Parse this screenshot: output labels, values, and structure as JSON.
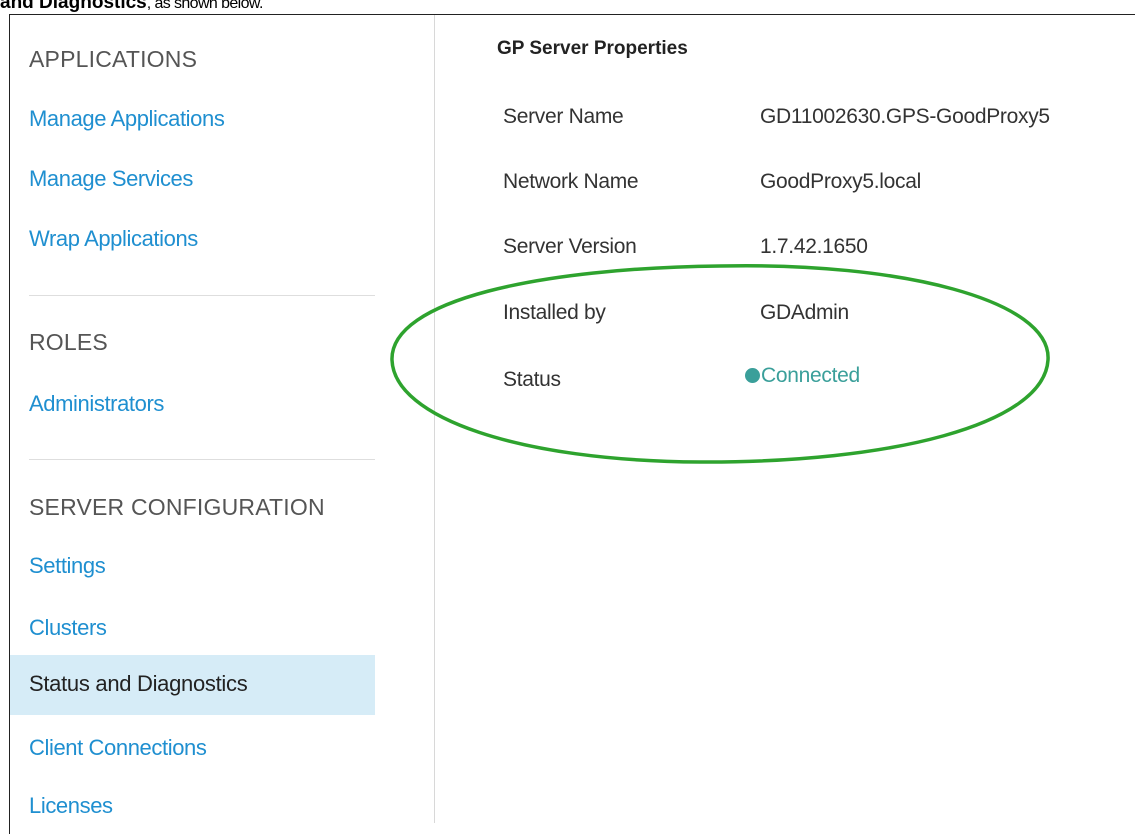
{
  "caption": {
    "bold_text": "and Diagnostics",
    "rest_text": ", as shown below."
  },
  "sidebar": {
    "sections": [
      {
        "heading": "APPLICATIONS",
        "items": [
          "Manage Applications",
          "Manage Services",
          "Wrap Applications"
        ]
      },
      {
        "heading": "ROLES",
        "items": [
          "Administrators"
        ]
      },
      {
        "heading": "SERVER CONFIGURATION",
        "items": [
          "Settings",
          "Clusters",
          "Status and Diagnostics",
          "Client Connections",
          "Licenses"
        ]
      }
    ],
    "active_item": "Status and Diagnostics"
  },
  "main": {
    "title": "GP Server Properties",
    "properties": [
      {
        "label": "Server Name",
        "value": "GD11002630.GPS-GoodProxy5"
      },
      {
        "label": "Network Name",
        "value": "GoodProxy5.local"
      },
      {
        "label": "Server Version",
        "value": "1.7.42.1650"
      },
      {
        "label": "Installed by",
        "value": "GDAdmin"
      },
      {
        "label": "Status",
        "value": "Connected"
      }
    ]
  },
  "colors": {
    "link": "#1f8fd0",
    "active_bg": "#d6ecf7",
    "status_connected": "#3a9f9a",
    "highlight_ellipse": "#2ea32e"
  }
}
